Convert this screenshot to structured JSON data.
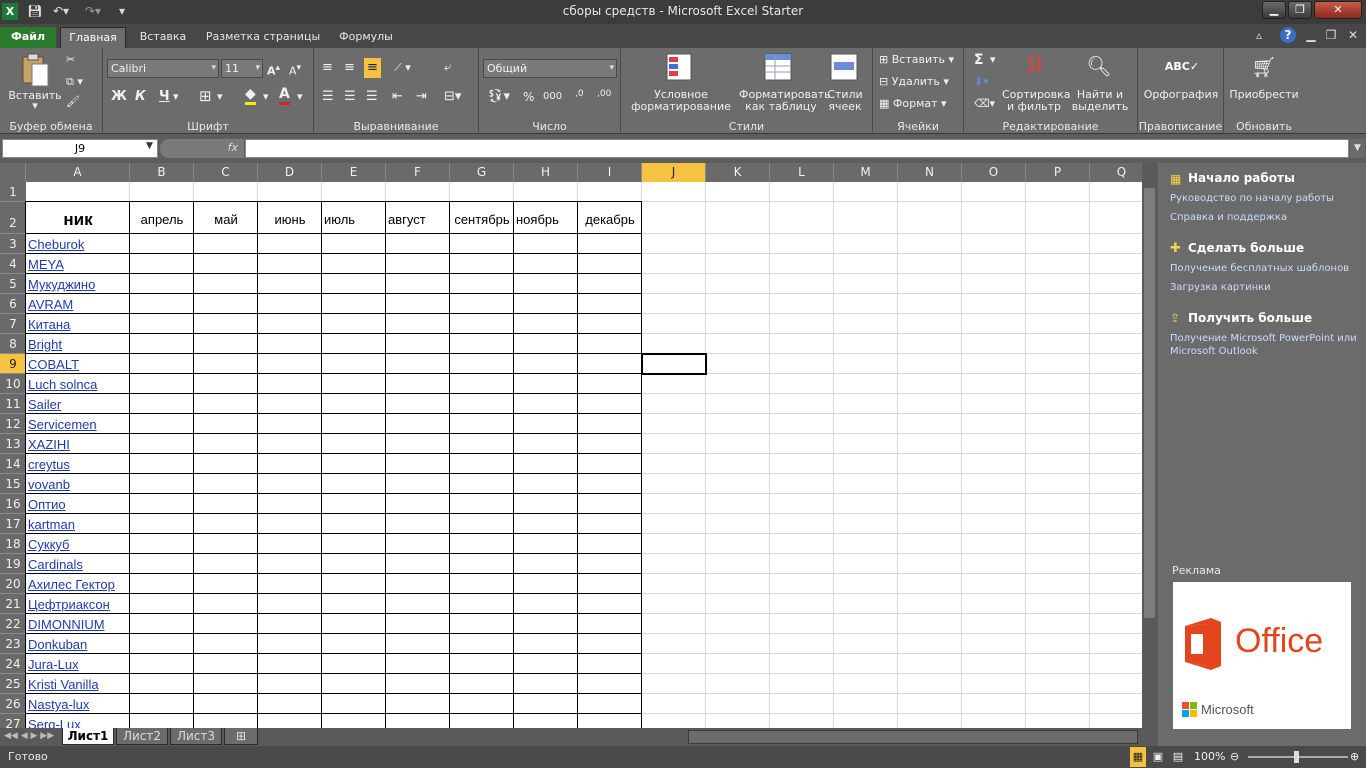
{
  "window": {
    "title": "сборы средств  -  Microsoft Excel Starter",
    "minimize": "▁",
    "maximize": "❐",
    "close": "✕"
  },
  "tabs": [
    "Файл",
    "Главная",
    "Вставка",
    "Разметка страницы",
    "Формулы"
  ],
  "ribbon": {
    "clipboard": {
      "paste": "Вставить",
      "group": "Буфер обмена"
    },
    "font": {
      "name": "Calibri",
      "size": "11",
      "bold": "Ж",
      "italic": "К",
      "underline": "Ч",
      "group": "Шрифт"
    },
    "alignment": {
      "group": "Выравнивание"
    },
    "number": {
      "format": "Общий",
      "percent": "%",
      "thousands": "000",
      "group": "Число"
    },
    "styles": {
      "conditional": "Условное форматирование",
      "table": "Форматировать как таблицу",
      "cellstyles": "Стили ячеек",
      "group": "Стили"
    },
    "cells": {
      "insert": "Вставить",
      "delete": "Удалить",
      "format": "Формат",
      "group": "Ячейки"
    },
    "editing": {
      "sum": "Σ",
      "sort": "Сортировка и фильтр",
      "find": "Найти и выделить",
      "group": "Редактирование"
    },
    "proofing": {
      "spelling": "Орфография",
      "group": "Правописание"
    },
    "update": {
      "label": "Приобрести",
      "group": "Обновить"
    }
  },
  "formula_bar": {
    "name_box": "J9",
    "fx": "fx",
    "value": ""
  },
  "columns": [
    "A",
    "B",
    "C",
    "D",
    "E",
    "F",
    "G",
    "H",
    "I",
    "J",
    "K",
    "L",
    "M",
    "N",
    "O",
    "P",
    "Q"
  ],
  "selected_column": "J",
  "selected_row": "9",
  "header_row": {
    "nick": "ник",
    "months": [
      "апрель",
      "май",
      "июнь",
      "июль",
      "август",
      "сентябрь",
      "ноябрь",
      "декабрь"
    ]
  },
  "rows": [
    {
      "num": "1",
      "nick": ""
    },
    {
      "num": "2",
      "nick": ""
    },
    {
      "num": "3",
      "nick": "Cheburok"
    },
    {
      "num": "4",
      "nick": "MEYA"
    },
    {
      "num": "5",
      "nick": "Мукуджино"
    },
    {
      "num": "6",
      "nick": "AVRAM"
    },
    {
      "num": "7",
      "nick": "Китана"
    },
    {
      "num": "8",
      "nick": "Bright"
    },
    {
      "num": "9",
      "nick": "COBALT"
    },
    {
      "num": "10",
      "nick": "Luch solnca"
    },
    {
      "num": "11",
      "nick": "Sailer"
    },
    {
      "num": "12",
      "nick": "Servicemen"
    },
    {
      "num": "13",
      "nick": "XAZIHI"
    },
    {
      "num": "14",
      "nick": "creytus"
    },
    {
      "num": "15",
      "nick": "vovanb"
    },
    {
      "num": "16",
      "nick": "Оптио"
    },
    {
      "num": "17",
      "nick": "kartman"
    },
    {
      "num": "18",
      "nick": "Суккуб"
    },
    {
      "num": "19",
      "nick": "Cardinals"
    },
    {
      "num": "20",
      "nick": "Ахилес Гектор"
    },
    {
      "num": "21",
      "nick": "Цефтриаксон"
    },
    {
      "num": "22",
      "nick": "DIMONNIUM"
    },
    {
      "num": "23",
      "nick": "Donkuban"
    },
    {
      "num": "24",
      "nick": "Jura-Lux"
    },
    {
      "num": "25",
      "nick": "Kristi Vanilla"
    },
    {
      "num": "26",
      "nick": "Nastya-lux"
    },
    {
      "num": "27",
      "nick": "Serg-Lux"
    }
  ],
  "sheets": [
    "Лист1",
    "Лист2",
    "Лист3"
  ],
  "status": {
    "ready": "Готово",
    "zoom": "100%"
  },
  "pane": {
    "start_title": "Начало работы",
    "start_links": [
      "Руководство по началу работы",
      "Справка и поддержка"
    ],
    "more_title": "Сделать больше",
    "more_links": [
      "Получение бесплатных шаблонов",
      "Загрузка картинки"
    ],
    "get_title": "Получить больше",
    "get_links": [
      "Получение Microsoft PowerPoint или Microsoft Outlook"
    ],
    "ad_label": "Реклама",
    "ad_office": "Office",
    "ad_microsoft": "Microsoft"
  },
  "colors": {
    "selection": "#f5c242",
    "link": "#1f3ab0",
    "office": "#e3461c",
    "file_tab": "#2b7a2b"
  }
}
